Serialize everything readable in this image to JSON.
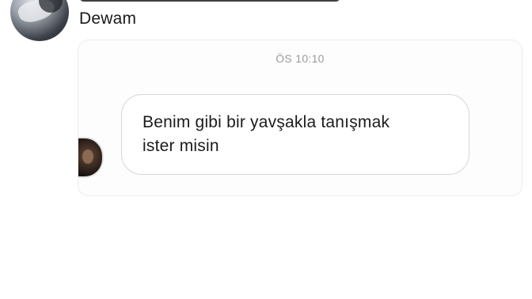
{
  "post": {
    "caption": "Dewam"
  },
  "chat": {
    "timestamp": "ÖS 10:10",
    "message": "Benim gibi bir yavşakla tanışmak\nister misin"
  }
}
